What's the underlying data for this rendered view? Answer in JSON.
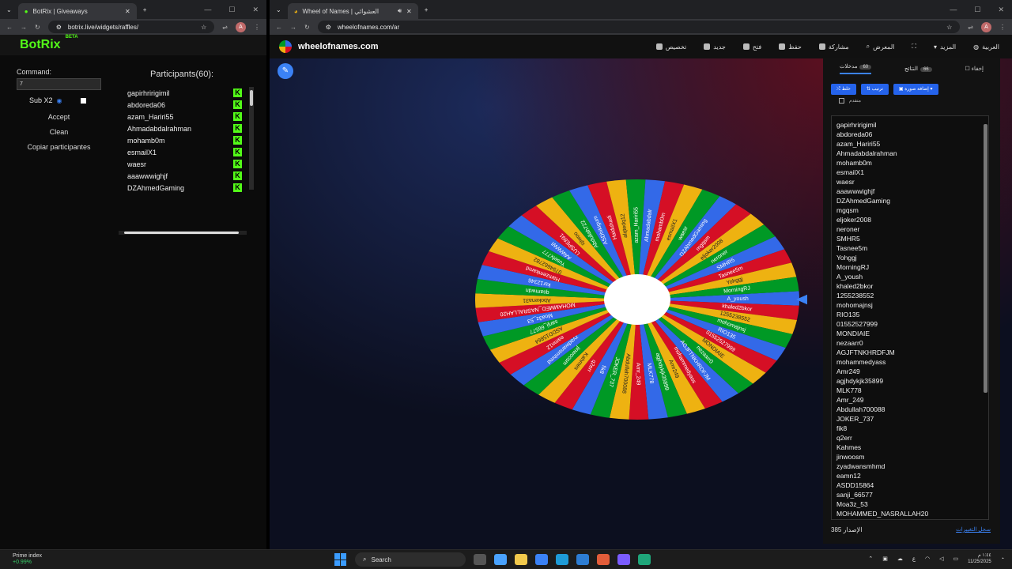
{
  "left_browser": {
    "tab_title": "BotRix | Giveaways",
    "url": "botrix.live/widgets/raffles/",
    "avatar": "A"
  },
  "botrix": {
    "logo": "BotRix",
    "logo_badge": "BETA",
    "command_label": "Command:",
    "command_value": "7",
    "sub_label": "Sub X2",
    "accept": "Accept",
    "clean": "Clean",
    "copy": "Copiar participantes",
    "participants_title": "Participants(60):",
    "participants": [
      "gapirhririgimil",
      "abdoreda06",
      "azam_Hariri55",
      "Ahmadabdalrahman",
      "mohamb0m",
      "esmailX1",
      "waesr",
      "aaawwwighjf",
      "DZAhmedGaming"
    ]
  },
  "right_browser": {
    "tab_title": "Wheel of Names | العشوائي",
    "url": "wheelofnames.com/ar",
    "avatar": "A"
  },
  "won": {
    "brand": "wheelofnames.com",
    "menu": [
      "تخصيص",
      "جديد",
      "فتح",
      "حفظ",
      "مشاركة",
      "المعرض",
      "",
      "المزيد",
      "العربية"
    ],
    "tabs": {
      "entries": "مدخلات",
      "entries_count": "60",
      "results": "النتائج",
      "results_count": "66",
      "hide": "إخفاء"
    },
    "buttons": [
      "خلط",
      "ترتيب",
      "إضافة صورة"
    ],
    "advanced": "متقدم",
    "names": [
      "gapirhririgimil",
      "abdoreda06",
      "azam_Hariri55",
      "Ahmadabdalrahman",
      "mohamb0m",
      "esmailX1",
      "waesr",
      "aaawwwighjf",
      "DZAhmedGaming",
      "mgqsm",
      "eljoker2008",
      "neroner",
      "SMHR5",
      "Tasnee5m",
      "Yohggj",
      "MorningRJ",
      "A_yoush",
      "khaled2bkor",
      "1255238552",
      "mohomajnsj",
      "RIO135",
      "01552527999",
      "MONDIAIE",
      "nezaarr0",
      "AGJFTNKHRDFJM",
      "mohammedyass",
      "Amr249",
      "agjhdykjk35899",
      "MLK778",
      "Amr_249",
      "Abdullah700088",
      "JOKER_737",
      "fik8",
      "q2err",
      "Kahmes",
      "jinwoosm",
      "zyadwansmhmd",
      "eamn12",
      "ASDD15864",
      "sanji_66577",
      "Moa3z_53",
      "MOHAMMED_NASRALLAH20"
    ],
    "wheel_names": [
      "A_yoush",
      "khaled2bkor",
      "1255238552",
      "mohomajnsj",
      "RIO135",
      "01552527999",
      "MONDIAIE",
      "nezaarr0",
      "AGJFTNKHRDFJM",
      "mohammedyass",
      "Amr249",
      "agjhdykjk35899",
      "MLK778",
      "Amr_249",
      "Abdullah700088",
      "JOKER_737",
      "fik8",
      "q2err",
      "Kahmes",
      "jinwoosm",
      "zyadwansmhmd",
      "eamn12",
      "ASDD15864",
      "sanji_66577",
      "Moa3z_53",
      "MOHAMMED_NASRALLAH20",
      "Abokena31",
      "qsamwdn",
      "ksr12346",
      "Hamzemkamd",
      "0794662782",
      "Yusefx777",
      "AAWWWI",
      "LUSPE891",
      "sjiwoo",
      "Abdullah722",
      "ASDhikigum",
      "Haiduhadi",
      "alqtedq12",
      "azam_Hariri55",
      "Ahmadabdalr",
      "mohamb0m",
      "esmailX1",
      "waesr",
      "DZAhmedGaming",
      "mgqsm",
      "eljoker2008",
      "neroner",
      "SMHR5",
      "Tasnee5m",
      "Yohggj",
      "MorningRJ"
    ],
    "footer_version": "385 الإصدار",
    "footer_link": "سجل التغييرات",
    "colors": [
      "#3369e8",
      "#d50f25",
      "#eeb211",
      "#009925"
    ]
  },
  "taskbar": {
    "market_name": "Prime index",
    "market_change": "+0.99%",
    "search": "Search",
    "time": "١:٤٤ م",
    "date": "11/25/2025",
    "lang": "ع"
  }
}
